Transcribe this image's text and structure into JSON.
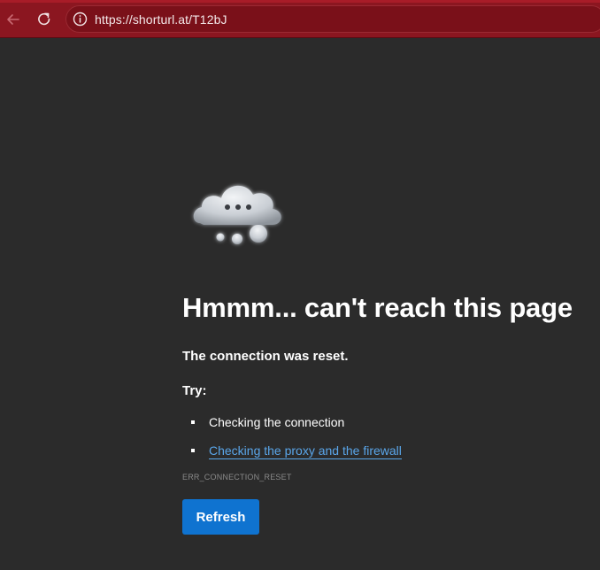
{
  "browser": {
    "address_bar": {
      "url": "https://shorturl.at/T12bJ"
    },
    "icons": {
      "back": "arrow-left-icon",
      "refresh": "refresh-icon",
      "site_info": "info-circle-icon"
    },
    "colors": {
      "toolbar": "#8b1620",
      "address_bar": "#7a1019"
    }
  },
  "error_page": {
    "illustration": "cloud-thinking-icon",
    "title": "Hmmm... can't reach this page",
    "subtitle": "The connection was reset.",
    "try_label": "Try:",
    "suggestions": [
      {
        "text": "Checking the connection",
        "is_link": false
      },
      {
        "text": "Checking the proxy and the firewall",
        "is_link": true
      }
    ],
    "error_code": "ERR_CONNECTION_RESET",
    "refresh_label": "Refresh",
    "colors": {
      "background": "#2b2b2b",
      "link": "#5aa6ea",
      "primary_button": "#0f73d0"
    }
  }
}
